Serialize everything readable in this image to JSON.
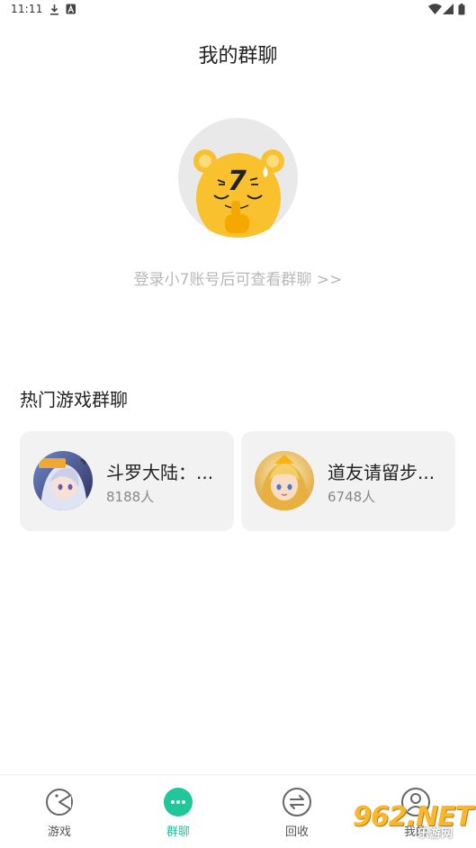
{
  "status_bar": {
    "time": "11:11",
    "icons": [
      "download-icon",
      "a-badge-icon",
      "wifi-icon",
      "signal-icon",
      "battery-icon"
    ]
  },
  "header": {
    "title": "我的群聊"
  },
  "login": {
    "mascot_icon": "bear-mascot-shush-icon",
    "prompt": "登录小7账号后可查看群聊 >>"
  },
  "hot_groups": {
    "title": "热门游戏群聊",
    "items": [
      {
        "name": "斗罗大陆：...",
        "count": "8188人",
        "avatar_icon": "anime-girl-avatar"
      },
      {
        "name": "道友请留步...",
        "count": "6748人",
        "avatar_icon": "golden-hero-avatar"
      }
    ]
  },
  "bottom_nav": {
    "active_color": "#1fc79a",
    "items": [
      {
        "label": "游戏",
        "icon": "pacman-icon",
        "active": false
      },
      {
        "label": "群聊",
        "icon": "chat-bubble-icon",
        "active": true
      },
      {
        "label": "回收",
        "icon": "swap-arrows-icon",
        "active": false
      },
      {
        "label": "我的",
        "icon": "user-icon",
        "active": false
      }
    ]
  },
  "watermark": {
    "main": "962.NET",
    "sub": "乐游网"
  },
  "colors": {
    "accent": "#1fc79a",
    "mascot": "#f9c12e",
    "card_bg": "#f2f2f2",
    "muted_text": "#b8b8b8"
  }
}
